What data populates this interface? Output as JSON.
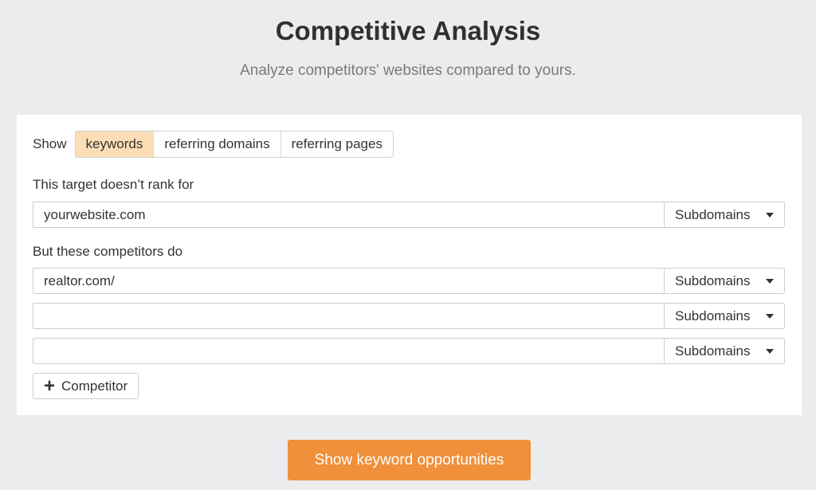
{
  "header": {
    "title": "Competitive Analysis",
    "subtitle": "Analyze competitors' websites compared to yours."
  },
  "show": {
    "label": "Show",
    "options": [
      {
        "label": "keywords",
        "active": true
      },
      {
        "label": "referring domains",
        "active": false
      },
      {
        "label": "referring pages",
        "active": false
      }
    ]
  },
  "target": {
    "label": "This target doesn’t rank for",
    "value": "yourwebsite.com",
    "mode": "Subdomains"
  },
  "competitors": {
    "label": "But these competitors do",
    "rows": [
      {
        "value": "realtor.com/",
        "mode": "Subdomains"
      },
      {
        "value": "",
        "mode": "Subdomains"
      },
      {
        "value": "",
        "mode": "Subdomains"
      }
    ],
    "add_label": "Competitor"
  },
  "submit": {
    "label": "Show keyword opportunities"
  },
  "colors": {
    "accent": "#f0903a",
    "active_tab": "#fbdeb5",
    "background": "#ebecee"
  }
}
